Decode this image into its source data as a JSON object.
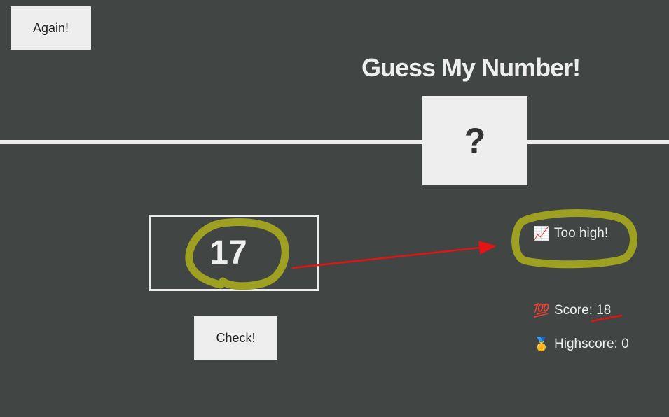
{
  "buttons": {
    "again": "Again!",
    "check": "Check!"
  },
  "title": "Guess My Number!",
  "secret_display": "?",
  "guess_input": {
    "value": "17"
  },
  "message": {
    "icon": "📈",
    "text": "Too high!"
  },
  "score": {
    "icon": "💯",
    "label": "Score:",
    "value": "18"
  },
  "highscore": {
    "icon": "🥇",
    "label": "Highscore:",
    "value": "0"
  },
  "colors": {
    "background": "#414543",
    "foreground": "#eeeeee",
    "annotation_highlight": "#9ea021",
    "annotation_arrow": "#e21414"
  }
}
